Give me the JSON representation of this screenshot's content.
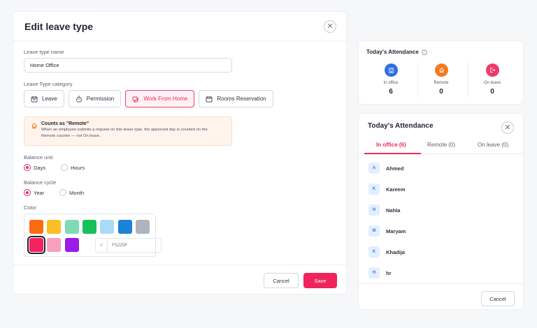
{
  "edit_modal": {
    "title": "Edit leave type",
    "name_label": "Leave type name",
    "name_value": "Home Office",
    "category_label": "Leave Type category",
    "categories": [
      {
        "label": "Leave",
        "icon": "calendar-icon",
        "active": false
      },
      {
        "label": "Permission",
        "icon": "stopwatch-icon",
        "active": false
      },
      {
        "label": "Work From Home",
        "icon": "home-desk-icon",
        "active": true
      },
      {
        "label": "Rooms Reservation",
        "icon": "calendar-icon",
        "active": false
      }
    ],
    "callout": {
      "title": "Counts as \"Remote\"",
      "line1": "When an employee submits a request on this leave type, the approved day is counted on the",
      "line2": "Remote counter — not On leave."
    },
    "balance_unit_label": "Balance unit",
    "balance_unit_options": [
      "Days",
      "Hours"
    ],
    "balance_unit_selected": "Days",
    "balance_cycle_label": "Balance cycle",
    "balance_cycle_options": [
      "Year",
      "Month"
    ],
    "balance_cycle_selected": "Year",
    "color_label": "Color",
    "swatches": [
      "#fb6b12",
      "#fbbf24",
      "#7edbb5",
      "#16c05a",
      "#a9dbf7",
      "#1b82d8",
      "#aeb4be",
      "#F5225F",
      "#f7a1bd",
      "#9b1be6"
    ],
    "selected_color": "#F5225F",
    "hex_prefix": "#",
    "hex_value": "F5225F",
    "cancel_label": "Cancel",
    "save_label": "Save"
  },
  "attendance_widget": {
    "title": "Today's Attendance",
    "stats": [
      {
        "label": "In office",
        "value": "6",
        "color": "#2f6fe4",
        "icon": "building-icon"
      },
      {
        "label": "Remote",
        "value": "0",
        "color": "#f7791d",
        "icon": "home-icon"
      },
      {
        "label": "On leave",
        "value": "0",
        "color": "#f03a6b",
        "icon": "logout-icon"
      }
    ]
  },
  "attendance_modal": {
    "title": "Today's Attendance",
    "tabs": [
      "In office (6)",
      "Remote (0)",
      "On leave (0)"
    ],
    "active_tab": 0,
    "people": [
      {
        "initial": "A",
        "name": "Ahmed"
      },
      {
        "initial": "K",
        "name": "Kareem"
      },
      {
        "initial": "N",
        "name": "Nahla"
      },
      {
        "initial": "M",
        "name": "Maryam"
      },
      {
        "initial": "K",
        "name": "Khadija"
      },
      {
        "initial": "H",
        "name": "hr"
      }
    ],
    "cancel_label": "Cancel"
  }
}
